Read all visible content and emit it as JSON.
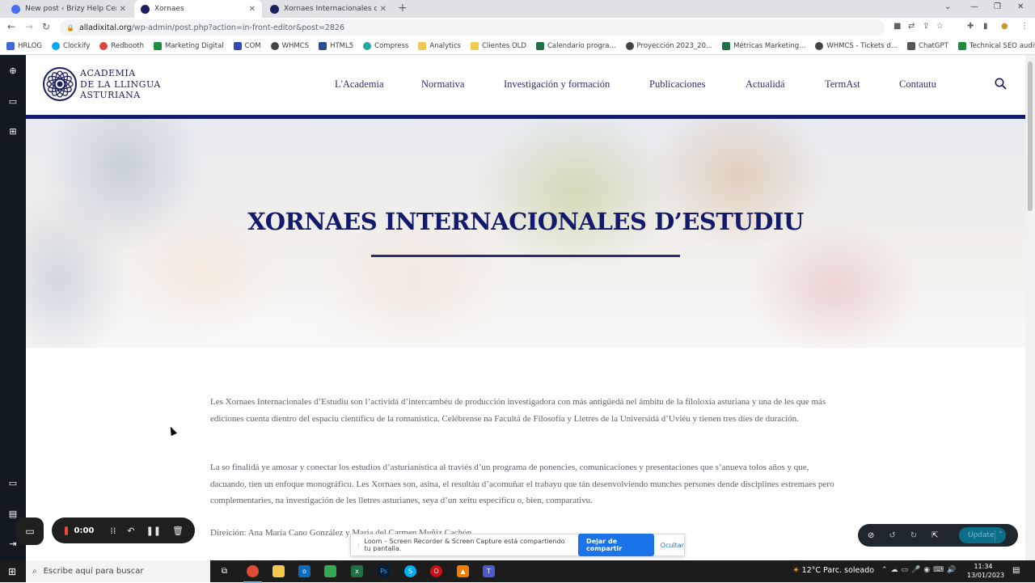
{
  "browser": {
    "tabs": [
      {
        "title": "New post ‹ Brizy Help Center",
        "active": false,
        "color": "#4a6cf7"
      },
      {
        "title": "Xornaes",
        "active": true,
        "color": "#1a1f5e"
      },
      {
        "title": "Xornaes Internacionales d'Estudi",
        "active": false,
        "color": "#1a1f5e"
      }
    ],
    "url_host": "alladixital.org",
    "url_path": "/wp-admin/post.php?action=in-front-editor&post=2826",
    "bookmarks": [
      "HRLOG",
      "Clockify",
      "Redbooth",
      "Marketing Digital",
      "COM",
      "WHMCS",
      "HTML5",
      "Compress",
      "Analytics",
      "Clientes OLD",
      "Calendario progra...",
      "Proyección 2023_20...",
      "Métricas Marketing...",
      "WHMCS - Tickets d...",
      "ChatGPT",
      "Technical SEO audit..."
    ]
  },
  "site": {
    "logo_lines": [
      "ACADEMIA",
      "DE LA LLINGUA",
      "ASTURIANA"
    ],
    "nav": [
      "L'Academia",
      "Normativa",
      "Investigación y formación",
      "Publicaciones",
      "Actualidá",
      "TermAst",
      "Contautu"
    ],
    "brand_color": "#141a6b"
  },
  "hero": {
    "title": "XORNAES INTERNACIONALES D’ESTUDIU"
  },
  "content": {
    "p1": "Les Xornaes Internacionales d’Estudiu son l’actividá d’intercambéu de producción investigadora con más antigüedá nel ámbitu de la filoloxía asturiana y una de les que más ediciones cuenta dientro del espaciu científicu de la romanística. Celébrense na Facultá de Filosofía y Lletres de la Universidá d’Uviéu y tienen tres díes de duración.",
    "p2": "La so finalidá ye amosar y conectar los estudios d’asturianística al traviés d’un programa de ponencies, comunicaciones y presentaciones que s’anueva tolos años y que, dacuando, tien un enfoque monográficu. Les Xornaes son, asina, el resultáu d’acomuñar el trabayu que tán desenvolviendo munches persones dende disciplines estremaes pero complementaries, na investigación de les lletres asturianes, seya d’un xeitu específicu o, bien, comparativu.",
    "p3": "Direición: Ana María Cano González y María del Carmen Muñiz Cachón"
  },
  "loom": {
    "time": "0:00",
    "share_text": "Loom – Screen Recorder & Screen Capture está compartiendo tu pantalla.",
    "stop_share": "Dejar de compartir",
    "hide": "Ocultar"
  },
  "editor": {
    "update_label": "Update"
  },
  "taskbar": {
    "search_placeholder": "Escribe aquí para buscar",
    "weather": "12°C  Parc. soleado",
    "time": "11:34",
    "date": "13/01/2023"
  }
}
